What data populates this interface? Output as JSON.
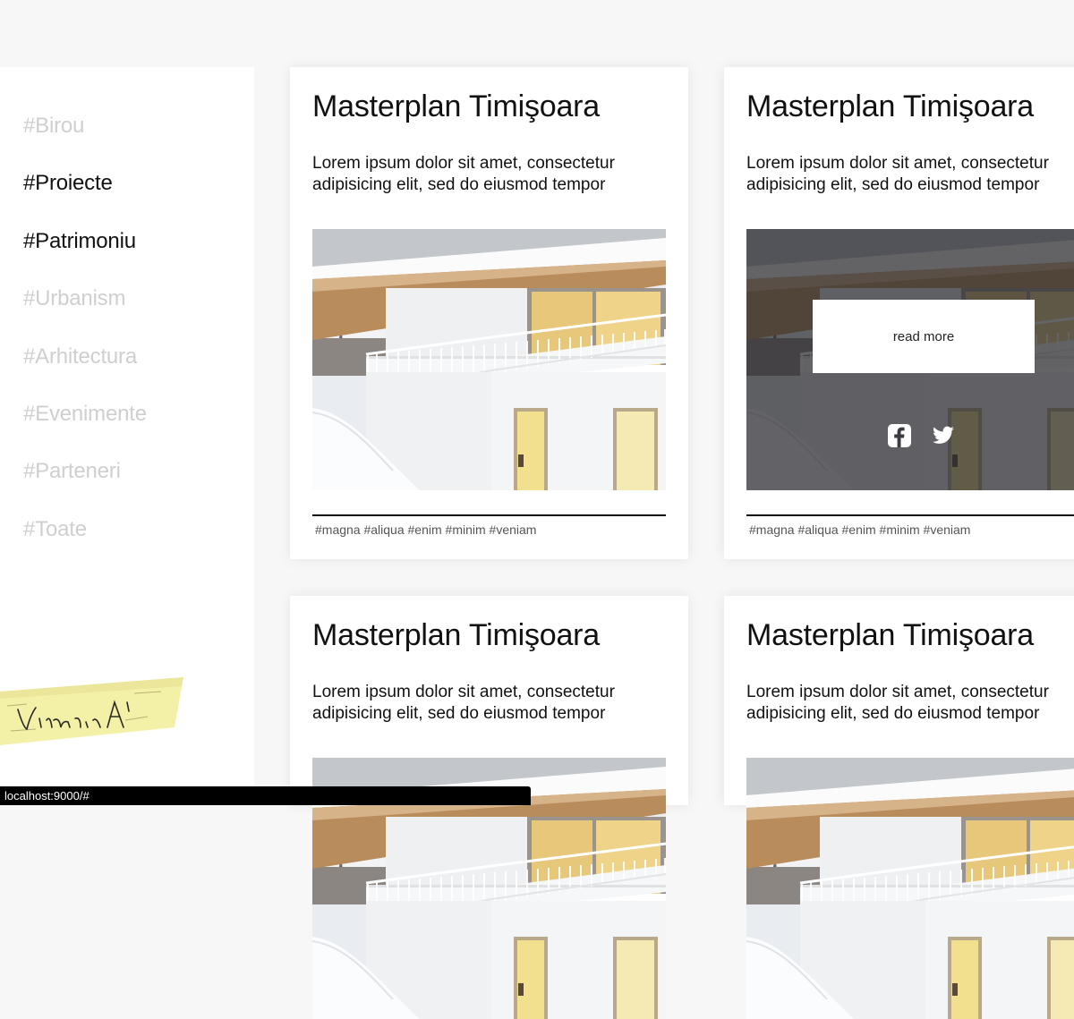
{
  "sidebar": {
    "items": [
      {
        "label": "#Birou",
        "active": false
      },
      {
        "label": "#Proiecte",
        "active": true
      },
      {
        "label": "#Patrimoniu",
        "active": true
      },
      {
        "label": "#Urbanism",
        "active": false
      },
      {
        "label": "#Arhitectura",
        "active": false
      },
      {
        "label": "#Evenimente",
        "active": false
      },
      {
        "label": "#Parteneri",
        "active": false
      },
      {
        "label": "#Toate",
        "active": false
      }
    ],
    "logo_text": "Vitamin A"
  },
  "cards": [
    {
      "title": "Masterplan Timişoara",
      "text": "Lorem ipsum dolor sit amet, consectetur adipisicing elit, sed do eiusmod tempor",
      "tags": "#magna #aliqua #enim #minim #veniam"
    },
    {
      "title": "Masterplan Timişoara",
      "text": "Lorem ipsum dolor sit amet, consectetur adipisicing elit, sed do eiusmod tempor",
      "tags": "#magna #aliqua #enim #minim #veniam",
      "hover": {
        "read_more": "read more",
        "icons": [
          "facebook-icon",
          "twitter-icon"
        ]
      }
    },
    {
      "title": "Masterplan Timişoara",
      "text": "Lorem ipsum dolor sit amet, consectetur adipisicing elit, sed do eiusmod tempor"
    },
    {
      "title": "Masterplan Timişoara",
      "text": "Lorem ipsum dolor sit amet, consectetur adipisicing elit, sed do eiusmod tempor"
    }
  ],
  "status_url": "localhost:9000/#",
  "colors": {
    "background": "#f7f7f7",
    "nav_inactive": "#cfcfcf",
    "nav_active": "#111111",
    "tape": "#f3f0a8"
  }
}
